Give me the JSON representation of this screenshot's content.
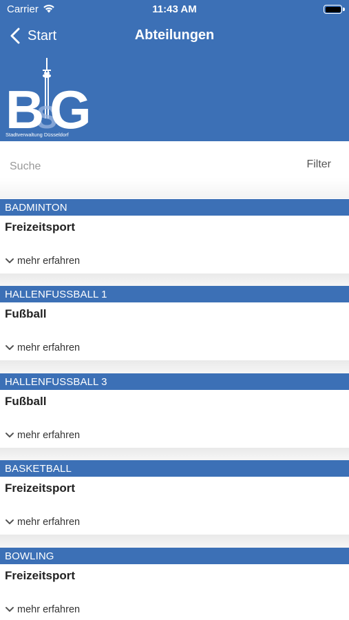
{
  "status_bar": {
    "carrier": "Carrier",
    "time": "11:43 AM"
  },
  "nav": {
    "back_label": "Start",
    "title": "Abteilungen"
  },
  "logo": {
    "letters": "BSG",
    "caption": "Stadtverwaltung Düsseldorf"
  },
  "search": {
    "placeholder": "Suche",
    "value": "",
    "filter_label": "Filter"
  },
  "colors": {
    "brand_blue": "#3c70b6",
    "background": "#ffffff"
  },
  "departments": [
    {
      "name": "BADMINTON",
      "category": "Freizeitsport",
      "more_label": "mehr erfahren"
    },
    {
      "name": "HALLENFUSSBALL 1",
      "category": "Fußball",
      "more_label": "mehr erfahren"
    },
    {
      "name": "HALLENFUSSBALL 3",
      "category": "Fußball",
      "more_label": "mehr erfahren"
    },
    {
      "name": "BASKETBALL",
      "category": "Freizeitsport",
      "more_label": "mehr erfahren"
    },
    {
      "name": "BOWLING",
      "category": "Freizeitsport",
      "more_label": "mehr erfahren"
    }
  ]
}
